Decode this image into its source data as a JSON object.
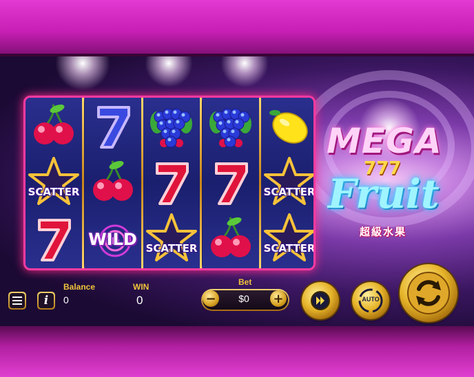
{
  "game": {
    "logo": {
      "word1": "MEGA",
      "digits": "777",
      "word2": "Fruit",
      "subtitle_cn": "超級水果"
    }
  },
  "reels": [
    [
      "cherry",
      "scatter",
      "seven"
    ],
    [
      "seven-blue",
      "cherry",
      "wild"
    ],
    [
      "grapes",
      "seven",
      "scatter"
    ],
    [
      "grapes",
      "seven",
      "cherry"
    ],
    [
      "lemon",
      "scatter",
      "scatter"
    ]
  ],
  "symbols": {
    "scatter_label": "SCATTER",
    "wild_label": "WILD"
  },
  "hud": {
    "menu_icon": "hamburger-menu-icon",
    "info_icon": "info-icon",
    "info_label": "i",
    "balance_label": "Balance",
    "balance_value": "0",
    "win_label": "WIN",
    "win_value": "0",
    "bet_label": "Bet",
    "bet_value": "$0",
    "minus_label": "−",
    "plus_label": "+",
    "turbo_icon": "fast-forward-icon",
    "auto_label": "AUTO",
    "spin_icon": "spin-arrows-icon"
  },
  "colors": {
    "accent_gold": "#f2c33a",
    "frame_pink": "#ff3aa0",
    "reel_bg": "#1a1f6e"
  }
}
